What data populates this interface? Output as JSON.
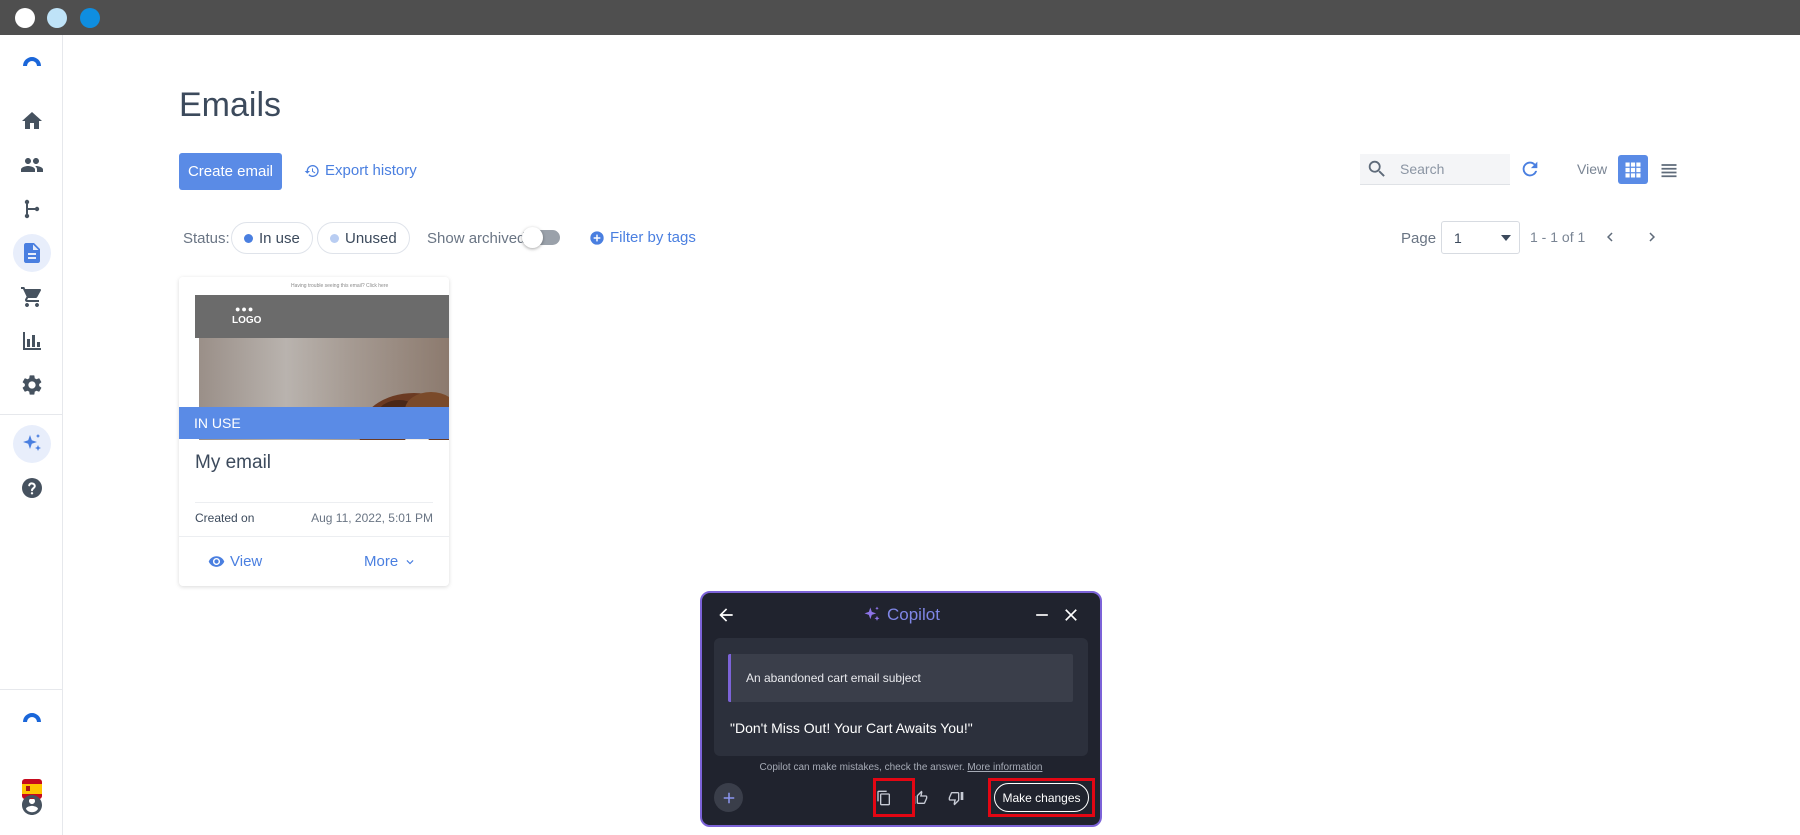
{
  "window": {
    "dot_colors": [
      "#ffffff",
      "#bfe3f8",
      "#0f8ee0"
    ]
  },
  "sidebar": {
    "items": [
      {
        "icon": "home-icon"
      },
      {
        "icon": "contacts-icon"
      },
      {
        "icon": "automation-icon"
      },
      {
        "icon": "document-icon",
        "active": true
      },
      {
        "icon": "cart-icon"
      },
      {
        "icon": "reports-icon"
      },
      {
        "icon": "settings-icon"
      },
      {
        "icon": "sparkle-icon"
      },
      {
        "icon": "help-icon"
      }
    ],
    "bottom": [
      "brand-logo-icon",
      "spain-flag-icon",
      "user-icon"
    ]
  },
  "page": {
    "title": "Emails"
  },
  "toolbar": {
    "create_label": "Create email",
    "export_label": "Export history",
    "search_placeholder": "Search",
    "view_label": "View"
  },
  "filters": {
    "status_label": "Status:",
    "in_use_label": "In use",
    "unused_label": "Unused",
    "show_archived_label": "Show archived",
    "filter_tags_label": "Filter by tags",
    "show_archived_on": false
  },
  "pagination": {
    "page_label": "Page",
    "page_value": "1",
    "range_label": "1 - 1 of 1"
  },
  "cards": [
    {
      "status_badge": "IN USE",
      "title": "My email",
      "created_label": "Created on",
      "created_value": "Aug 11, 2022, 5:01 PM",
      "view_label": "View",
      "more_label": "More",
      "thumbnail": {
        "logo_text": "LOGO",
        "note": "Having trouble seeing this email? Click here"
      }
    }
  ],
  "copilot": {
    "title": "Copilot",
    "prompt": "An abandoned cart email subject",
    "answer": "\"Don't Miss Out! Your Cart Awaits You!\"",
    "disclaimer": "Copilot can make mistakes, check the answer.",
    "more_info": "More information",
    "make_changes_label": "Make changes"
  },
  "colors": {
    "accent": "#5a8be6",
    "copilot_bg": "#20232e",
    "copilot_border": "#7c63d8",
    "highlight": "#e30613"
  }
}
